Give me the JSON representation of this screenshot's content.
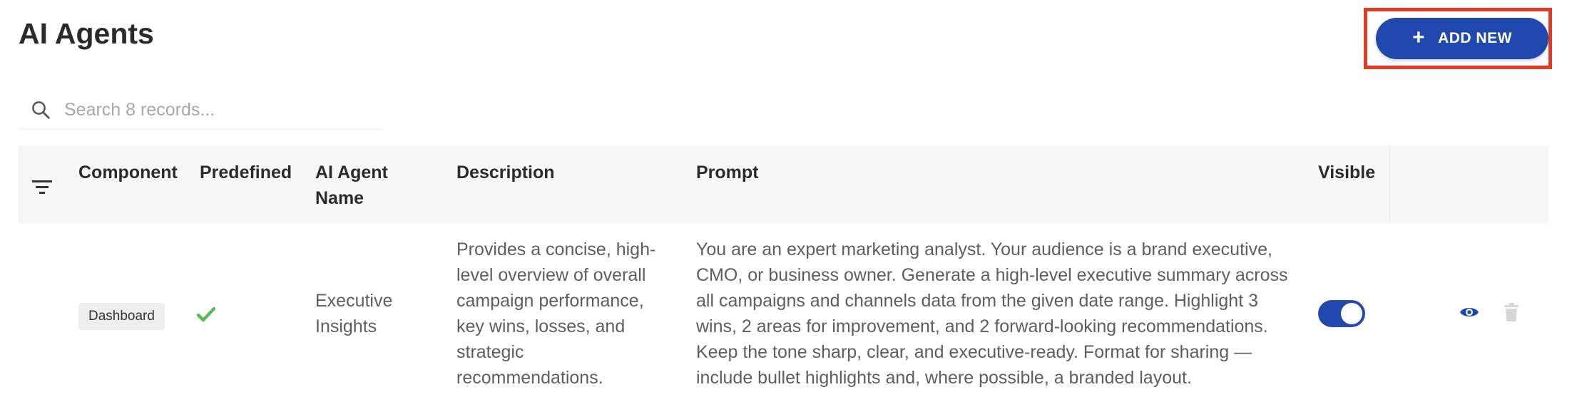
{
  "page": {
    "title": "AI Agents"
  },
  "toolbar": {
    "add_label": "ADD NEW",
    "add_icon": "+"
  },
  "search": {
    "placeholder": "Search 8 records..."
  },
  "table": {
    "columns": {
      "component": "Component",
      "predefined": "Predefined",
      "name": "AI Agent Name",
      "description": "Description",
      "prompt": "Prompt",
      "visible": "Visible"
    },
    "rows": [
      {
        "component": "Dashboard",
        "predefined": true,
        "name": "Executive Insights",
        "description": "Provides a concise, high-level overview of overall campaign performance, key wins, losses, and strategic recommendations.",
        "prompt": "You are an expert marketing analyst. Your audience is a brand executive, CMO, or business owner. Generate a high-level executive summary across all campaigns and channels data from the given date range. Highlight 3 wins, 2 areas for improvement, and 2 forward-looking recommendations. Keep the tone sharp, clear, and executive-ready. Format for sharing — include bullet highlights and, where possible, a branded layout.",
        "visible": true
      }
    ]
  },
  "colors": {
    "primary": "#2148AD",
    "highlight": "#E23B26",
    "check": "#5CB85C",
    "header_bg": "#F7F7F7"
  },
  "icons": {
    "search": "search-icon",
    "filter": "filter-icon",
    "check": "check-icon",
    "view": "eye-icon",
    "delete": "trash-icon"
  }
}
